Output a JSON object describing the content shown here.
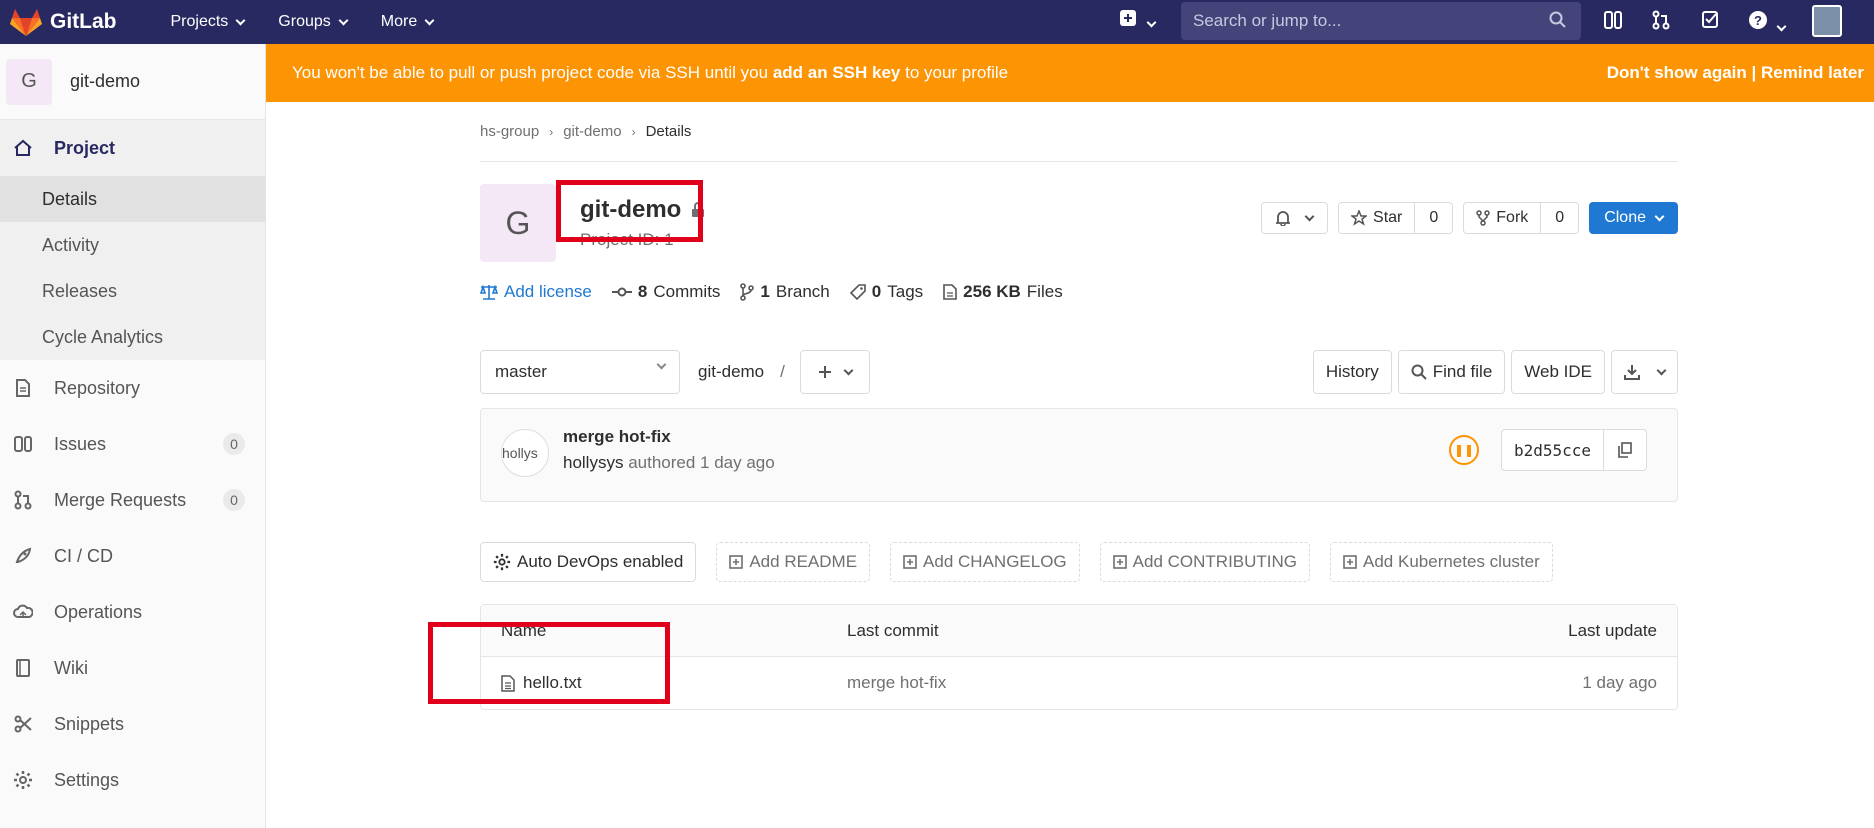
{
  "topbar": {
    "brand": "GitLab",
    "nav": [
      "Projects",
      "Groups",
      "More"
    ],
    "search_placeholder": "Search or jump to..."
  },
  "sidebar": {
    "project_initial": "G",
    "project_name": "git-demo",
    "project_label": "Project",
    "sub_items": [
      "Details",
      "Activity",
      "Releases",
      "Cycle Analytics"
    ],
    "items": [
      {
        "label": "Repository",
        "icon": "doc-icon"
      },
      {
        "label": "Issues",
        "icon": "issues-icon",
        "count": "0"
      },
      {
        "label": "Merge Requests",
        "icon": "merge-icon",
        "count": "0"
      },
      {
        "label": "CI / CD",
        "icon": "rocket-icon"
      },
      {
        "label": "Operations",
        "icon": "cloud-icon"
      },
      {
        "label": "Wiki",
        "icon": "book-icon"
      },
      {
        "label": "Snippets",
        "icon": "scissors-icon"
      },
      {
        "label": "Settings",
        "icon": "gear-icon"
      }
    ]
  },
  "banner": {
    "text_before": "You won't be able to pull or push project code via SSH until you ",
    "link": "add an SSH key",
    "text_after": " to your profile",
    "dont_show": "Don't show again",
    "sep": "|",
    "remind": "Remind later"
  },
  "breadcrumb": [
    "hs-group",
    "git-demo",
    "Details"
  ],
  "project": {
    "initial": "G",
    "title": "git-demo",
    "id_text": "Project ID: 1"
  },
  "actions": {
    "star": "Star",
    "star_count": "0",
    "fork": "Fork",
    "fork_count": "0",
    "clone": "Clone"
  },
  "stats": {
    "license": "Add license",
    "commits_n": "8",
    "commits": "Commits",
    "branch_n": "1",
    "branch": "Branch",
    "tags_n": "0",
    "tags": "Tags",
    "files_n": "256 KB",
    "files": "Files"
  },
  "tree": {
    "branch": "master",
    "path_root": "git-demo",
    "path_sep": "/",
    "history": "History",
    "find_file": "Find file",
    "web_ide": "Web IDE"
  },
  "commit": {
    "avatar_alt": "hollys",
    "title": "merge hot-fix",
    "author": "hollysys",
    "meta": "authored 1 day ago",
    "sha": "b2d55cce"
  },
  "shortcuts": [
    "Auto DevOps enabled",
    "Add README",
    "Add CHANGELOG",
    "Add CONTRIBUTING",
    "Add Kubernetes cluster"
  ],
  "table": {
    "headers": [
      "Name",
      "Last commit",
      "Last update"
    ],
    "rows": [
      {
        "name": "hello.txt",
        "commit": "merge hot-fix",
        "updated": "1 day ago"
      }
    ]
  },
  "colors": {
    "navbar": "#292961",
    "banner": "#fc9403",
    "accent": "#1f78d1",
    "highlight_box": "#e0001b"
  }
}
